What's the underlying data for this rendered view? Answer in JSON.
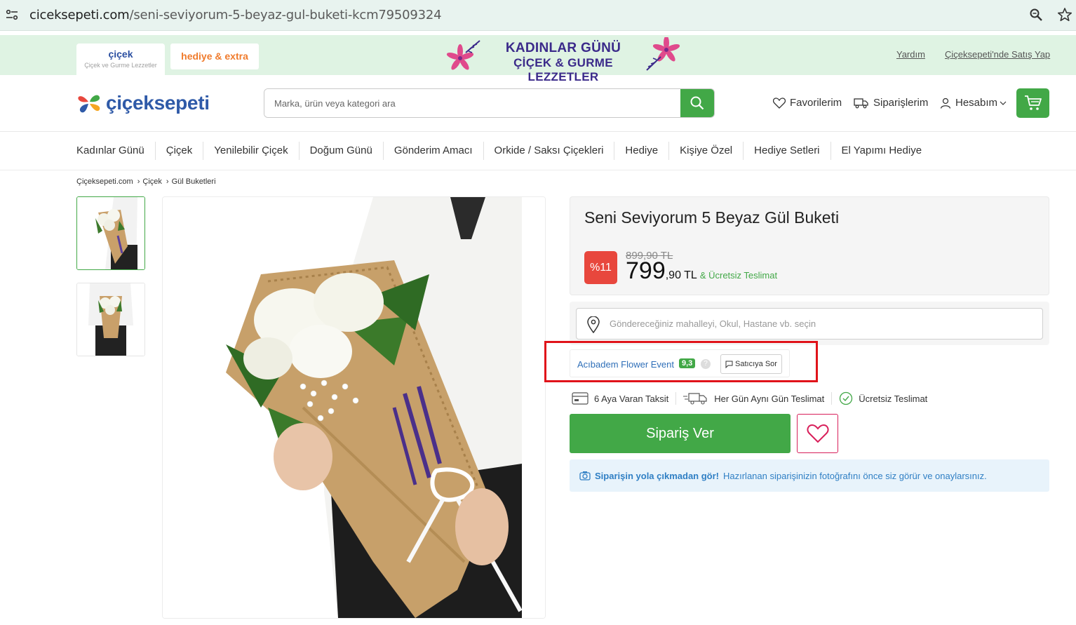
{
  "browser": {
    "url_domain": "ciceksepeti.com",
    "url_path": "/seni-seviyorum-5-beyaz-gul-buketi-kcm79509324"
  },
  "promo": {
    "tab_cicek_title": "çiçek",
    "tab_cicek_subtitle": "Çiçek ve Gurme Lezzetler",
    "tab_hediye": "hediye & extra",
    "banner_line1": "KADINLAR GÜNÜ",
    "banner_line2": "ÇİÇEK & GURME LEZZETLER",
    "help_link": "Yardım",
    "sell_link": "Çiçeksepeti'nde Satış Yap"
  },
  "header": {
    "logo_text": "çiçeksepeti",
    "search_placeholder": "Marka, ürün veya kategori ara",
    "favorites": "Favorilerim",
    "orders": "Siparişlerim",
    "account": "Hesabım"
  },
  "categories": [
    "Kadınlar Günü",
    "Çiçek",
    "Yenilebilir Çiçek",
    "Doğum Günü",
    "Gönderim Amacı",
    "Orkide / Saksı Çiçekleri",
    "Hediye",
    "Kişiye Özel",
    "Hediye Setleri",
    "El Yapımı Hediye"
  ],
  "breadcrumb": [
    "Çiçeksepeti.com",
    "Çiçek",
    "Gül Buketleri"
  ],
  "product": {
    "title": "Seni Seviyorum 5 Beyaz Gül Buketi",
    "discount": "%11",
    "old_price": "899,90 TL",
    "price_main": "799",
    "price_decimal": ",90 TL",
    "free_shipping": "& Ücretsiz Teslimat",
    "location_placeholder": "Göndereceğiniz mahalleyi, Okul, Hastane vb. seçin",
    "seller_name": "Acıbadem Flower Event",
    "seller_score": "9,3",
    "seller_help": "?",
    "ask_seller": "Satıcıya Sor",
    "features": [
      "6 Aya Varan Taksit",
      "Her Gün Aynı Gün Teslimat",
      "Ücretsiz Teslimat"
    ],
    "order_button": "Sipariş Ver",
    "info_bold": "Siparişin yola çıkmadan gör!",
    "info_text": "Hazırlanan siparişinizin fotoğrafını önce siz görür ve onaylarsınız."
  },
  "colors": {
    "brand_green": "#42a847",
    "discount_red": "#e8473d",
    "highlight_red": "#e0131a",
    "link_blue": "#2f6fb8"
  }
}
